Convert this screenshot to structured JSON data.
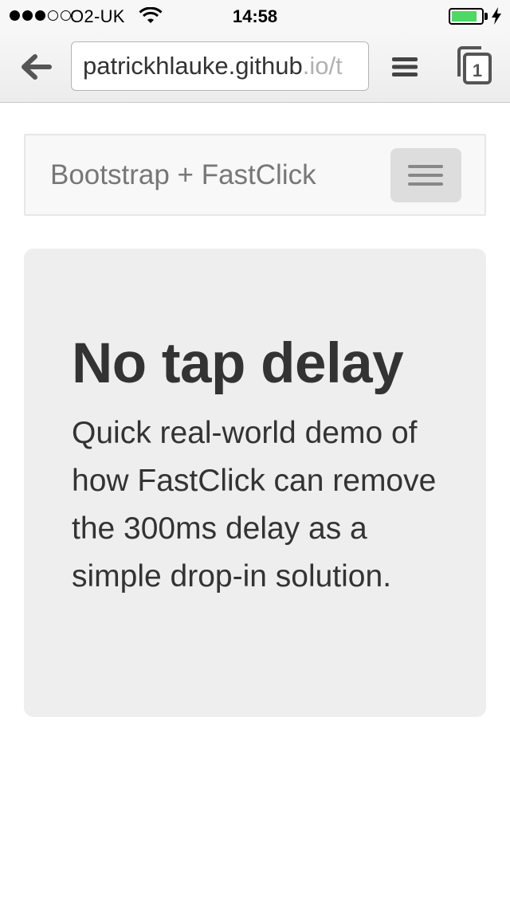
{
  "status_bar": {
    "carrier": "O2-UK",
    "time": "14:58",
    "signal_bars_filled": 3,
    "signal_bars_total": 5,
    "wifi_icon": "wifi-icon",
    "battery_level": 0.85,
    "battery_color": "#4cd964",
    "charging_icon": "bolt-icon"
  },
  "browser": {
    "url_host": "patrickhlauke.github",
    "url_suffix": ".io/t",
    "back_icon": "back-arrow-icon",
    "menu_icon": "menu-icon",
    "tab_count": "1"
  },
  "page": {
    "navbar": {
      "brand": "Bootstrap + FastClick",
      "toggle_icon": "hamburger-icon"
    },
    "jumbotron": {
      "headline": "No tap delay",
      "lead": "Quick real-world demo of how FastClick can remove the 300ms delay as a simple drop-in solution."
    }
  }
}
